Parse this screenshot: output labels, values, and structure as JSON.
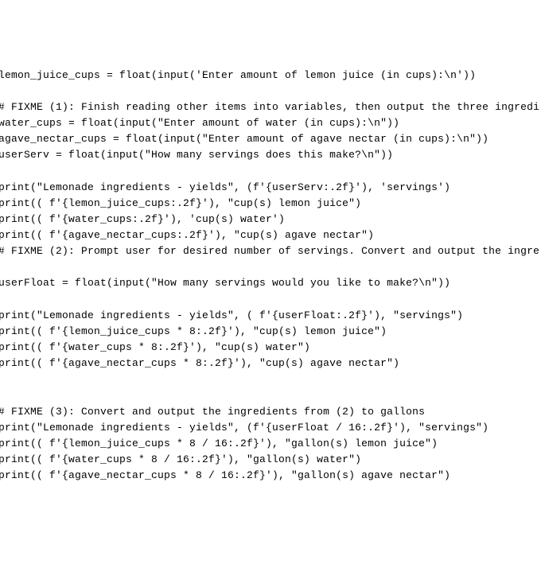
{
  "lines": [
    "lemon_juice_cups = float(input('Enter amount of lemon juice (in cups):\\n'))",
    "",
    "# FIXME (1): Finish reading other items into variables, then output the three ingredi",
    "water_cups = float(input(\"Enter amount of water (in cups):\\n\"))",
    "agave_nectar_cups = float(input(\"Enter amount of agave nectar (in cups):\\n\"))",
    "userServ = float(input(\"How many servings does this make?\\n\"))",
    "",
    "print(\"Lemonade ingredients - yields\", (f'{userServ:.2f}'), 'servings')",
    "print(( f'{lemon_juice_cups:.2f}'), \"cup(s) lemon juice\")",
    "print(( f'{water_cups:.2f}'), 'cup(s) water')",
    "print(( f'{agave_nectar_cups:.2f}'), \"cup(s) agave nectar\")",
    "# FIXME (2): Prompt user for desired number of servings. Convert and output the ingre",
    "",
    "userFloat = float(input(\"How many servings would you like to make?\\n\"))",
    "",
    "print(\"Lemonade ingredients - yields\", ( f'{userFloat:.2f}'), \"servings\")",
    "print(( f'{lemon_juice_cups * 8:.2f}'), \"cup(s) lemon juice\")",
    "print(( f'{water_cups * 8:.2f}'), \"cup(s) water\")",
    "print(( f'{agave_nectar_cups * 8:.2f}'), \"cup(s) agave nectar\")",
    "",
    "",
    "# FIXME (3): Convert and output the ingredients from (2) to gallons",
    "print(\"Lemonade ingredients - yields\", (f'{userFloat / 16:.2f}'), \"servings\")",
    "print(( f'{lemon_juice_cups * 8 / 16:.2f}'), \"gallon(s) lemon juice\")",
    "print(( f'{water_cups * 8 / 16:.2f}'), \"gallon(s) water\")",
    "print(( f'{agave_nectar_cups * 8 / 16:.2f}'), \"gallon(s) agave nectar\")"
  ]
}
